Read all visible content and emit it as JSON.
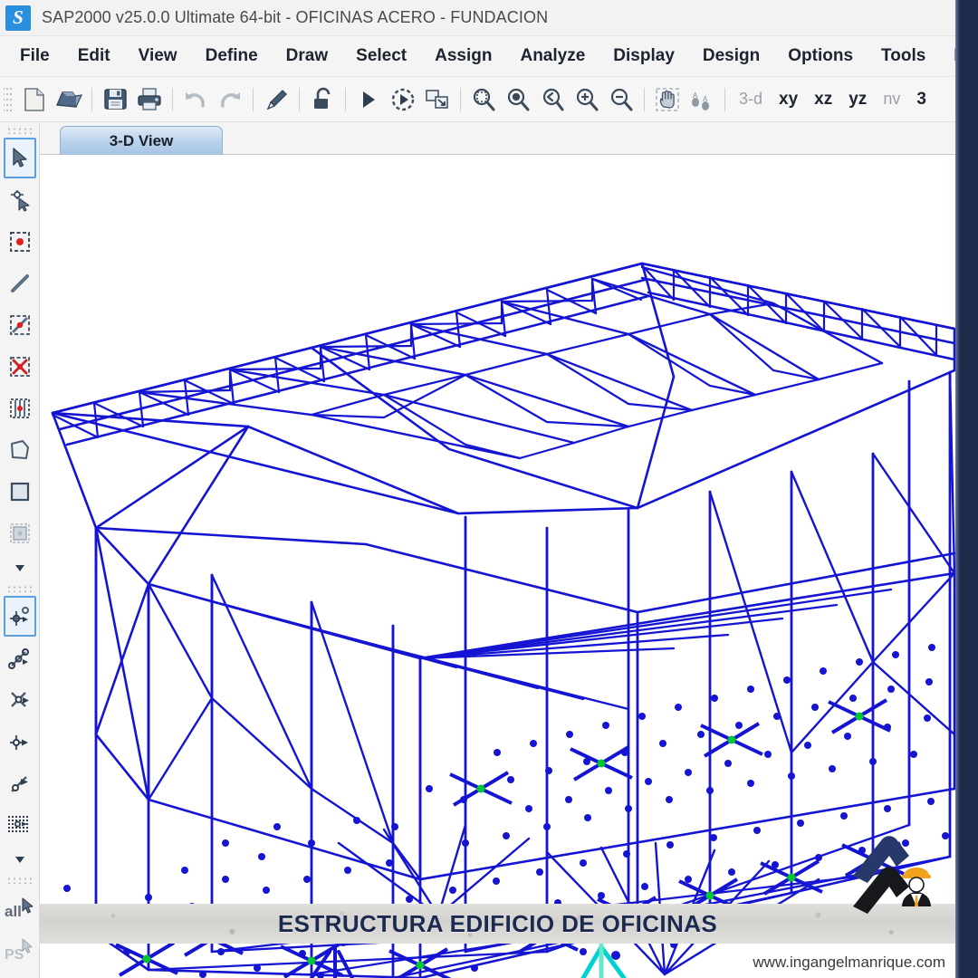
{
  "window": {
    "title": "SAP2000 v25.0.0 Ultimate 64-bit - OFICINAS ACERO - FUNDACION",
    "app_icon": "sap2000-logo-icon",
    "icon_letter": "S"
  },
  "menubar": {
    "items": [
      {
        "label": "File"
      },
      {
        "label": "Edit"
      },
      {
        "label": "View"
      },
      {
        "label": "Define"
      },
      {
        "label": "Draw"
      },
      {
        "label": "Select"
      },
      {
        "label": "Assign"
      },
      {
        "label": "Analyze"
      },
      {
        "label": "Display"
      },
      {
        "label": "Design"
      },
      {
        "label": "Options"
      },
      {
        "label": "Tools"
      },
      {
        "label": "H"
      }
    ]
  },
  "toolbar": {
    "buttons": [
      {
        "name": "new-file-icon",
        "tip": "New Model"
      },
      {
        "name": "open-file-icon",
        "tip": "Open Model"
      },
      {
        "name": "save-icon",
        "tip": "Save Model"
      },
      {
        "name": "print-icon",
        "tip": "Print Graphics"
      },
      {
        "name": "undo-icon",
        "tip": "Undo"
      },
      {
        "name": "redo-icon",
        "tip": "Redo"
      },
      {
        "name": "refresh-pencil-icon",
        "tip": "Refresh Window"
      },
      {
        "name": "lock-icon",
        "tip": "Lock / Unlock Model"
      },
      {
        "name": "run-analysis-icon",
        "tip": "Run Analysis"
      },
      {
        "name": "run-animation-icon",
        "tip": "Start Animation"
      },
      {
        "name": "rubber-band-zoom-icon",
        "tip": "Rubber Band Zoom"
      },
      {
        "name": "zoom-full-icon",
        "tip": "Restore Full View"
      },
      {
        "name": "zoom-previous-icon",
        "tip": "Restore Previous Zoom"
      },
      {
        "name": "zoom-in-icon",
        "tip": "Zoom In One Step"
      },
      {
        "name": "zoom-out-icon",
        "tip": "Zoom Out One Step"
      },
      {
        "name": "pan-hand-icon",
        "tip": "Pan"
      },
      {
        "name": "set-display-options-icon",
        "tip": "Set Display Options"
      }
    ],
    "view_buttons": [
      {
        "label": "3-d",
        "state": "disabled"
      },
      {
        "label": "xy",
        "state": "enabled"
      },
      {
        "label": "xz",
        "state": "enabled"
      },
      {
        "label": "yz",
        "state": "enabled"
      },
      {
        "label": "nv",
        "state": "disabled"
      }
    ],
    "perspective_label": "3"
  },
  "left_palette": {
    "groups": [
      {
        "items": [
          {
            "name": "select-pointer-icon",
            "label": "Select Objects",
            "active": true
          },
          {
            "name": "reshape-object-icon",
            "label": "Reshape Object",
            "active": false
          },
          {
            "name": "draw-point-icon",
            "label": "Draw Special Joint",
            "active": false
          },
          {
            "name": "draw-frame-icon",
            "label": "Draw Frame / Cable Element",
            "active": false
          },
          {
            "name": "quick-draw-frame-icon",
            "label": "Quick Draw Frame",
            "active": false
          },
          {
            "name": "quick-draw-brace-icon",
            "label": "Quick Draw Braces",
            "active": false
          },
          {
            "name": "quick-draw-secondary-beam-icon",
            "label": "Quick Draw Secondary Beams",
            "active": false
          },
          {
            "name": "draw-poly-area-icon",
            "label": "Draw Poly Area",
            "active": false
          },
          {
            "name": "draw-rectangular-area-icon",
            "label": "Draw Rectangular Area",
            "active": false
          },
          {
            "name": "quick-draw-area-icon",
            "label": "Quick Draw Area",
            "active": false
          },
          {
            "name": "more-draw-tools-icon",
            "label": "More Draw Tools",
            "active": false
          }
        ]
      },
      {
        "items": [
          {
            "name": "snap-point-grid-icon",
            "label": "Snap to Joints and Grid Points",
            "active": true
          },
          {
            "name": "snap-midpoint-ends-icon",
            "label": "Snap to Middle and Ends",
            "active": false
          },
          {
            "name": "snap-intersections-icon",
            "label": "Snap to Intersections",
            "active": false
          },
          {
            "name": "snap-perpendicular-icon",
            "label": "Snap to Perpendicular",
            "active": false
          },
          {
            "name": "snap-line-edge-icon",
            "label": "Snap to Lines and Edges",
            "active": false
          },
          {
            "name": "snap-fine-grid-icon",
            "label": "Snap to Fine Grid",
            "active": false
          },
          {
            "name": "more-snap-tools-icon",
            "label": "More Snap Options",
            "active": false
          }
        ]
      },
      {
        "items": [
          {
            "name": "select-all-icon",
            "label": "all",
            "active": false
          },
          {
            "name": "previous-selection-icon",
            "label": "PS",
            "active": false
          }
        ]
      }
    ]
  },
  "viewpane": {
    "tab_label": "3-D View"
  },
  "overlay": {
    "banner_text": "ESTRUCTURA EDIFICIO DE OFICINAS",
    "site_url": "www.ingangelmanrique.com",
    "logo_name": "ing-angel-manrique-logo"
  },
  "model": {
    "element_color": "#1414D2",
    "restraint_color": "#00C832",
    "axis_color": "#00D2D2",
    "background_color": "#FFFFFF",
    "description": "3-D steel office building frame with truss roof, braced bays, columns and foundation joint grid"
  }
}
